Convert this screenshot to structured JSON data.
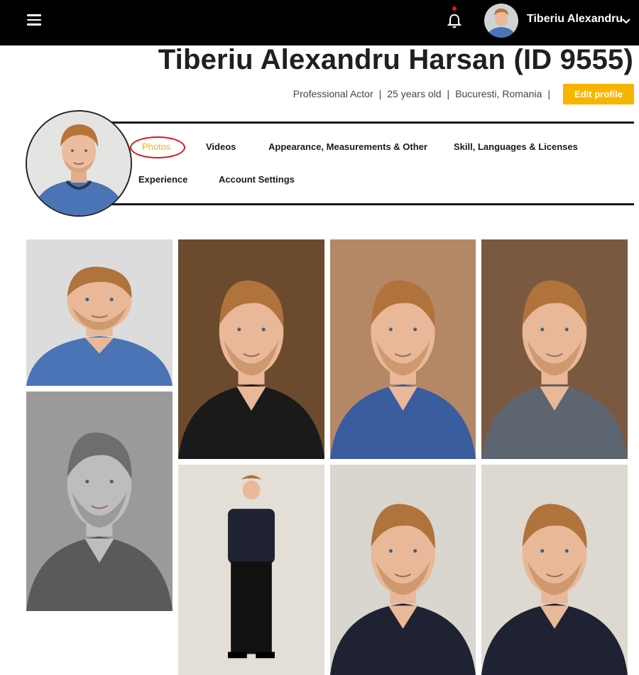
{
  "colors": {
    "topbar": "#000000",
    "accent": "#f7b500",
    "highlight_ring": "#e0141c",
    "notification_dot": "#e0141c",
    "text_dark": "#1a1a1a"
  },
  "topbar": {
    "menu_icon": "hamburger-menu-icon",
    "notification_icon": "bell-icon",
    "user_name": "Tiberiu Alexandru",
    "dropdown_icon": "chevron-down-icon"
  },
  "profile": {
    "title": "Tiberiu Alexandru Harsan (ID 9555)",
    "profession": "Professional Actor",
    "age": "25 years old",
    "location": "Bucuresti, Romania",
    "separator": "|",
    "edit_button": "Edit profile"
  },
  "tabs": [
    {
      "label": "Photos",
      "active": true
    },
    {
      "label": "Videos",
      "active": false
    },
    {
      "label": "Appearance, Measurements & Other",
      "active": false
    },
    {
      "label": "Skill, Languages & Licenses",
      "active": false
    },
    {
      "label": "Experience",
      "active": false
    },
    {
      "label": "Account Settings",
      "active": false
    }
  ],
  "photos": [
    {
      "alt": "headshot-blue-tshirt-smiling",
      "bg": "#dcdcdc",
      "shirt": "#4a74b5",
      "mono": false
    },
    {
      "alt": "portrait-black-tshirt-brown-background",
      "bg": "#6b4a2d",
      "shirt": "#1a1a1a",
      "mono": false
    },
    {
      "alt": "portrait-blue-shirt-tan-background",
      "bg": "#b48866",
      "shirt": "#3a5da0",
      "mono": false
    },
    {
      "alt": "portrait-grey-vneck-brown-background",
      "bg": "#7a5940",
      "shirt": "#5d6670",
      "mono": false
    },
    {
      "alt": "black-and-white-headshot",
      "bg": "#9a9a9a",
      "shirt": "#5a5a5a",
      "mono": true
    },
    {
      "alt": "full-body-standing-dark-shirt",
      "bg": "#e3ded6",
      "shirt": "#1e2233",
      "mono": false
    },
    {
      "alt": "close-up-face-smiling",
      "bg": "#d9d5cf",
      "shirt": "#1f2233",
      "mono": false
    },
    {
      "alt": "mid-shot-dark-button-shirt",
      "bg": "#ddd8d0",
      "shirt": "#1e2233",
      "mono": false
    }
  ]
}
